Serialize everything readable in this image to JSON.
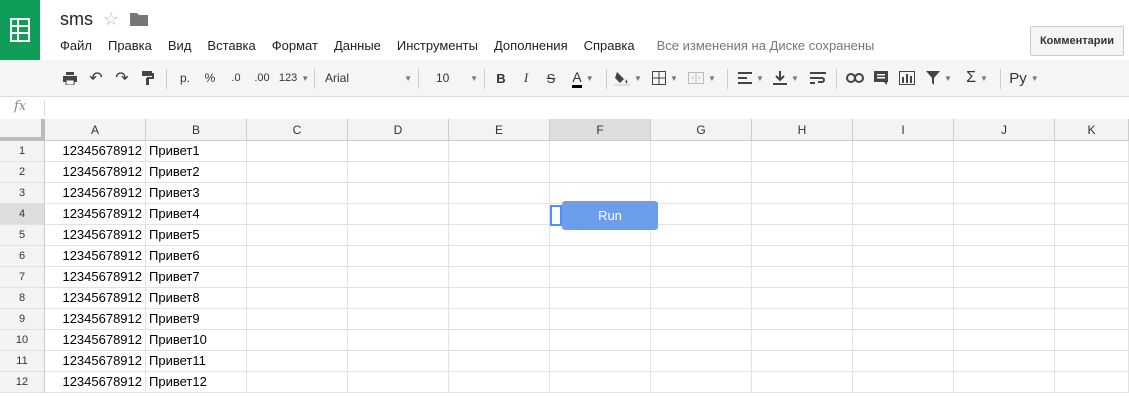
{
  "app": {
    "title": "sms",
    "saved_status": "Все изменения на Диске сохранены",
    "comments_label": "Комментарии",
    "accent": "#0f9d58"
  },
  "menu": [
    "Файл",
    "Правка",
    "Вид",
    "Вставка",
    "Формат",
    "Данные",
    "Инструменты",
    "Дополнения",
    "Справка"
  ],
  "toolbar": {
    "currency_label": "р.",
    "percent_label": "%",
    "decimal_decrease_label": ".0",
    "decimal_increase_label": ".00",
    "number_format_label": "123",
    "font_name": "Arial",
    "font_size": "10",
    "bold_label": "B",
    "italic_label": "I",
    "strike_label": "S",
    "text_color_label": "A",
    "input_tools_label": "Ру"
  },
  "formula_bar": {
    "fx_label": "fx",
    "value": ""
  },
  "grid": {
    "columns": [
      "A",
      "B",
      "C",
      "D",
      "E",
      "F",
      "G",
      "H",
      "I",
      "J",
      "K"
    ],
    "rows": [
      {
        "num": "1",
        "a": "12345678912",
        "b": "Привет1"
      },
      {
        "num": "2",
        "a": "12345678912",
        "b": "Привет2"
      },
      {
        "num": "3",
        "a": "12345678912",
        "b": "Привет3"
      },
      {
        "num": "4",
        "a": "12345678912",
        "b": "Привет4"
      },
      {
        "num": "5",
        "a": "12345678912",
        "b": "Привет5"
      },
      {
        "num": "6",
        "a": "12345678912",
        "b": "Привет6"
      },
      {
        "num": "7",
        "a": "12345678912",
        "b": "Привет7"
      },
      {
        "num": "8",
        "a": "12345678912",
        "b": "Привет8"
      },
      {
        "num": "9",
        "a": "12345678912",
        "b": "Привет9"
      },
      {
        "num": "10",
        "a": "12345678912",
        "b": "Привет10"
      },
      {
        "num": "11",
        "a": "12345678912",
        "b": "Привет11"
      },
      {
        "num": "12",
        "a": "12345678912",
        "b": "Привет12"
      }
    ],
    "selected_column": "F",
    "selected_row": "4"
  },
  "run_button": {
    "label": "Run",
    "color": "#6d9eeb"
  },
  "icons": [
    "sheets-logo-icon",
    "star-icon",
    "folder-icon",
    "print-icon",
    "undo-icon",
    "redo-icon",
    "paint-format-icon",
    "fill-color-icon",
    "borders-icon",
    "merge-cells-icon",
    "align-left-icon",
    "vertical-align-icon",
    "text-wrap-icon",
    "link-icon",
    "comment-icon",
    "chart-icon",
    "filter-icon",
    "functions-icon"
  ]
}
